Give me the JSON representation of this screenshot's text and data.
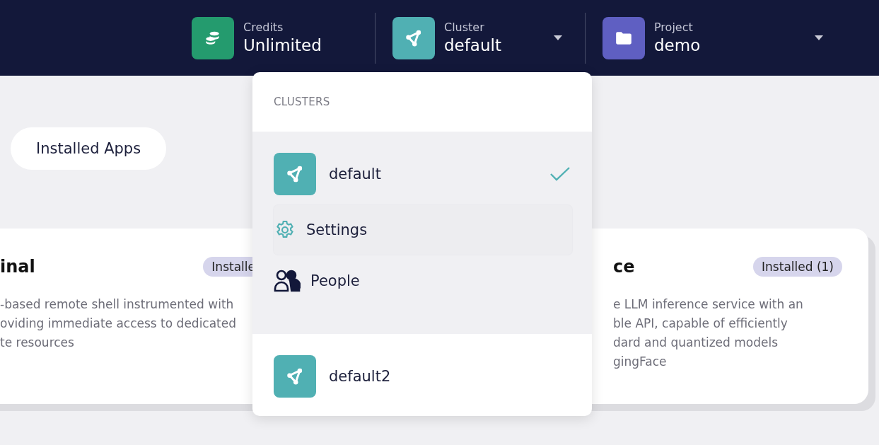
{
  "header": {
    "items": [
      {
        "kind": "credits",
        "label": "Credits",
        "value": "Unlimited",
        "dropdown": false
      },
      {
        "kind": "cluster",
        "label": "Cluster",
        "value": "default",
        "dropdown": true
      },
      {
        "kind": "project",
        "label": "Project",
        "value": "demo",
        "dropdown": true
      }
    ]
  },
  "installed_apps_button": "Installed Apps",
  "cards": [
    {
      "title": "inal",
      "badge": "Installe",
      "description": [
        "-based remote shell instrumented with",
        "oviding immediate access to dedicated",
        "te resources"
      ]
    },
    {
      "title": "ce",
      "badge": "Installed (1)",
      "description": [
        "e LLM inference service with an",
        "ble API, capable of efficiently",
        "dard and quantized models",
        "gingFace"
      ]
    }
  ],
  "cluster_menu": {
    "heading": "CLUSTERS",
    "clusters": [
      {
        "name": "default",
        "selected": true,
        "actions": [
          {
            "kind": "settings",
            "label": "Settings",
            "highlighted": true
          },
          {
            "kind": "people",
            "label": "People",
            "highlighted": false
          }
        ]
      },
      {
        "name": "default2",
        "selected": false
      }
    ]
  }
}
